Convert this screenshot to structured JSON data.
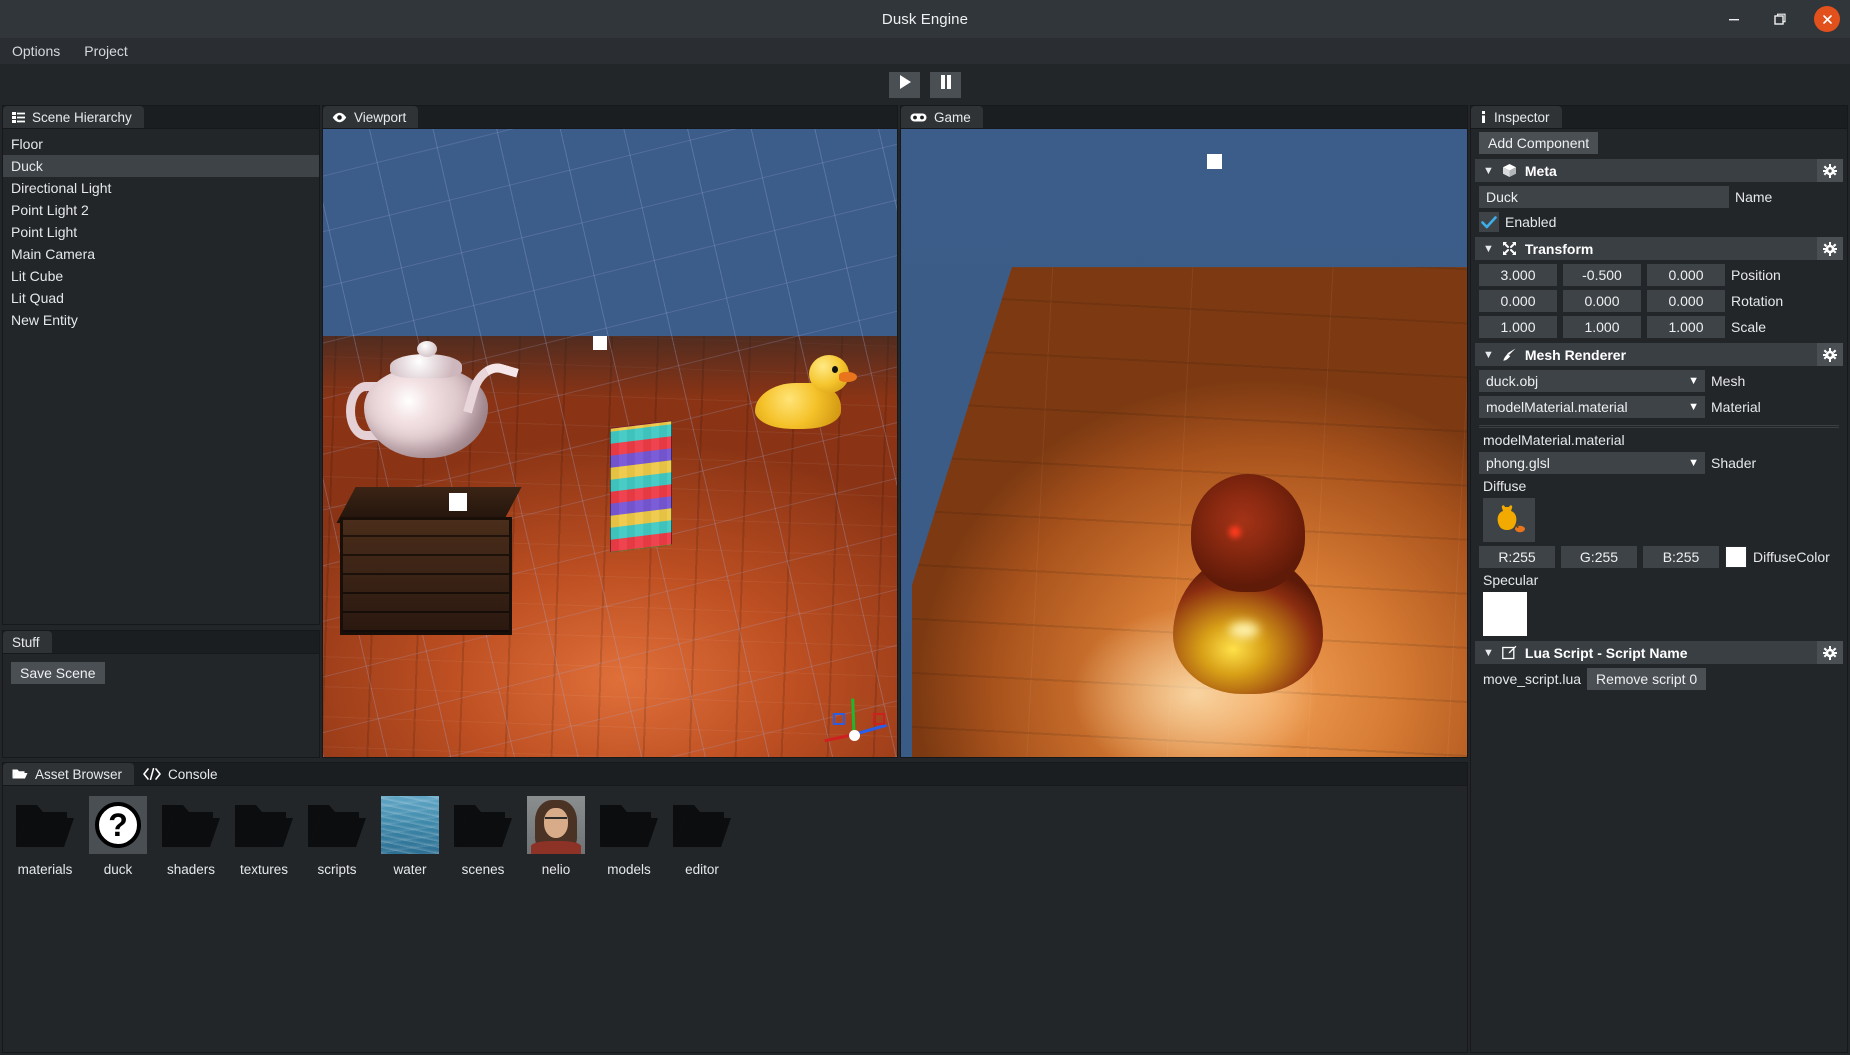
{
  "window": {
    "title": "Dusk Engine",
    "controls": {
      "minimize": "minimize-icon",
      "maximize": "maximize-icon",
      "close": "close-icon"
    }
  },
  "menubar": {
    "items": [
      "Options",
      "Project"
    ]
  },
  "toolbar": {
    "play": "play-icon",
    "pause": "pause-icon"
  },
  "hierarchy": {
    "tab_label": "Scene Hierarchy",
    "tab_icon": "list-icon",
    "items": [
      "Floor",
      "Duck",
      "Directional Light",
      "Point Light 2",
      "Point Light",
      "Main Camera",
      "Lit Cube",
      "Lit Quad",
      "New Entity"
    ],
    "selected": "Duck"
  },
  "stuff": {
    "tab_label": "Stuff",
    "save_scene_label": "Save Scene"
  },
  "viewport": {
    "tab_label": "Viewport",
    "tab_icon": "eye-icon"
  },
  "game": {
    "tab_label": "Game",
    "tab_icon": "gamepad-icon"
  },
  "inspector": {
    "tab_label": "Inspector",
    "tab_icon": "info-icon",
    "add_component_label": "Add Component",
    "components": {
      "meta": {
        "title": "Meta",
        "icon": "cube-icon",
        "gear": "gear-icon",
        "name_value": "Duck",
        "name_label": "Name",
        "enabled_label": "Enabled",
        "enabled_checked": true
      },
      "transform": {
        "title": "Transform",
        "icon": "move-icon",
        "gear": "gear-icon",
        "position": {
          "label": "Position",
          "x": "3.000",
          "y": "-0.500",
          "z": "0.000"
        },
        "rotation": {
          "label": "Rotation",
          "x": "0.000",
          "y": "0.000",
          "z": "0.000"
        },
        "scale": {
          "label": "Scale",
          "x": "1.000",
          "y": "1.000",
          "z": "1.000"
        }
      },
      "mesh_renderer": {
        "title": "Mesh Renderer",
        "icon": "brush-icon",
        "gear": "gear-icon",
        "mesh": {
          "value": "duck.obj",
          "label": "Mesh"
        },
        "material": {
          "value": "modelMaterial.material",
          "label": "Material"
        },
        "material_name": "modelMaterial.material",
        "shader": {
          "value": "phong.glsl",
          "label": "Shader"
        },
        "diffuse_label": "Diffuse",
        "diffuse_texture": "duck-texture-thumbnail",
        "diffuse_color": {
          "r": "R:255",
          "g": "G:255",
          "b": "B:255",
          "label": "DiffuseColor",
          "hex": "#ffffff"
        },
        "specular_label": "Specular",
        "specular_color": {
          "hex": "#ffffff"
        }
      },
      "lua_script": {
        "title": "Lua Script - Script Name",
        "icon": "edit-icon",
        "gear": "gear-icon",
        "script_name": "move_script.lua",
        "remove_label": "Remove script 0"
      }
    }
  },
  "assets": {
    "tabs": [
      {
        "label": "Asset Browser",
        "icon": "folder-open-icon",
        "active": true
      },
      {
        "label": "Console",
        "icon": "code-icon",
        "active": false
      }
    ],
    "items": [
      {
        "name": "materials",
        "kind": "folder"
      },
      {
        "name": "duck",
        "kind": "unknown"
      },
      {
        "name": "shaders",
        "kind": "folder"
      },
      {
        "name": "textures",
        "kind": "folder"
      },
      {
        "name": "scripts",
        "kind": "folder"
      },
      {
        "name": "water",
        "kind": "image-water"
      },
      {
        "name": "scenes",
        "kind": "folder"
      },
      {
        "name": "nelio",
        "kind": "image-portrait"
      },
      {
        "name": "models",
        "kind": "folder"
      },
      {
        "name": "editor",
        "kind": "folder"
      }
    ]
  },
  "colors": {
    "titlebar_bg": "#31363b",
    "panel_bg": "#232629",
    "tabstrip_bg": "#1b1e20",
    "header_bg": "#3a3f44",
    "field_bg": "#3e4347",
    "button_bg": "#4a4f54",
    "accent_close": "#e2501b",
    "check_blue": "#3daee9",
    "text": "#eff0f1",
    "sky": "#3c5c89"
  }
}
